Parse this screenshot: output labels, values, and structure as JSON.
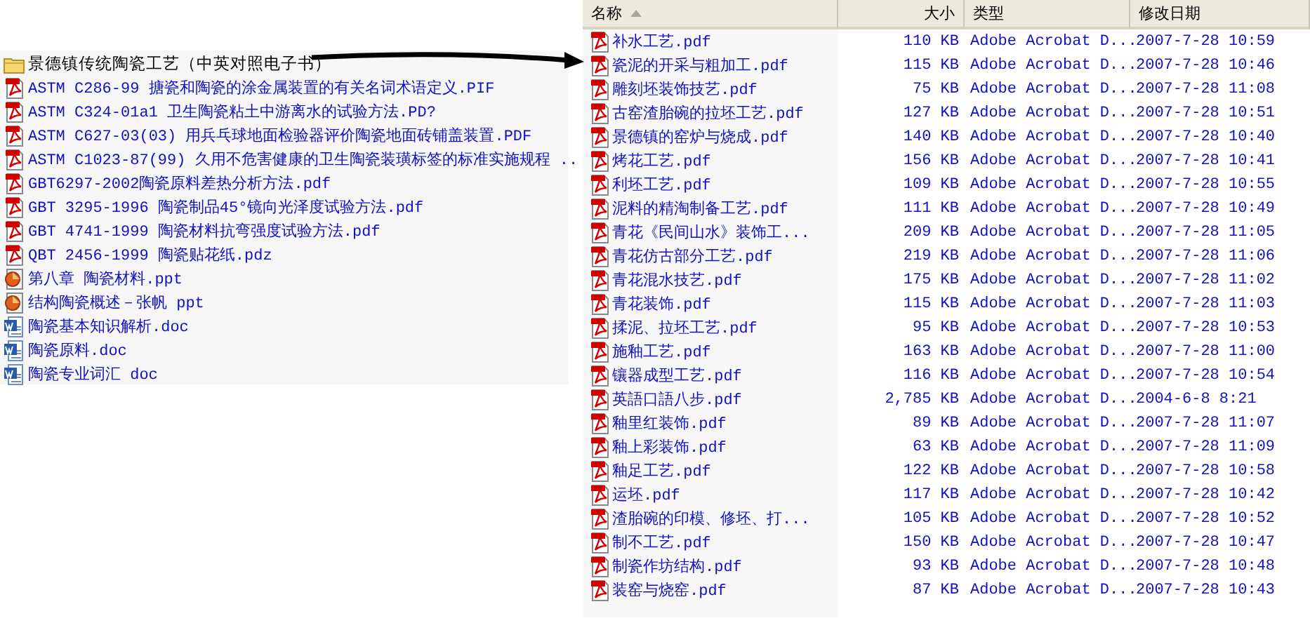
{
  "left_panel": {
    "folder": {
      "kind": "folder",
      "name": "景德镇传统陶瓷工艺（中英对照电子书）"
    },
    "files": [
      {
        "kind": "pdf",
        "name": "ASTM C286-99 搪瓷和陶瓷的涂金属装置的有关名词术语定义.PIF"
      },
      {
        "kind": "pdf",
        "name": "ASTM C324-01a1 卫生陶瓷粘土中游离水的试验方法.PD?"
      },
      {
        "kind": "pdf",
        "name": "ASTM C627-03(03)  用兵乓球地面检验器评价陶瓷地面砖铺盖装置.PDF"
      },
      {
        "kind": "pdf",
        "name": "ASTM C1023-87(99)  久用不危害健康的卫生陶瓷装璜标签的标准实施规程 .."
      },
      {
        "kind": "pdf",
        "name": "GBT6297-2002陶瓷原料差热分析方法.pdf"
      },
      {
        "kind": "pdf",
        "name": "GBT 3295-1996 陶瓷制品45°镜向光泽度试验方法.pdf"
      },
      {
        "kind": "pdf",
        "name": "GBT 4741-1999 陶瓷材料抗弯强度试验方法.pdf"
      },
      {
        "kind": "pdf",
        "name": "QBT 2456-1999 陶瓷贴花纸.pdz"
      },
      {
        "kind": "ppt",
        "name": "第八章 陶瓷材料.ppt"
      },
      {
        "kind": "ppt",
        "name": "结构陶瓷概述－张帆 ppt"
      },
      {
        "kind": "doc",
        "name": "陶瓷基本知识解析.doc"
      },
      {
        "kind": "doc",
        "name": "陶瓷原料.doc"
      },
      {
        "kind": "doc",
        "name": "陶瓷专业词汇 doc"
      }
    ]
  },
  "file_table": {
    "columns": [
      "名称",
      "大小",
      "类型",
      "修改日期"
    ],
    "rows": [
      {
        "kind": "pdf",
        "name": "补水工艺.pdf",
        "size": "110 KB",
        "type": "Adobe Acrobat D...",
        "modified": "2007-7-28 10:59"
      },
      {
        "kind": "pdf",
        "name": "瓷泥的开采与粗加工.pdf",
        "size": "115 KB",
        "type": "Adobe Acrobat D...",
        "modified": "2007-7-28 10:46"
      },
      {
        "kind": "pdf",
        "name": "雕刻坯装饰技艺.pdf",
        "size": "75 KB",
        "type": "Adobe Acrobat D...",
        "modified": "2007-7-28 11:08"
      },
      {
        "kind": "pdf",
        "name": "古窑渣胎碗的拉坯工艺.pdf",
        "size": "127 KB",
        "type": "Adobe Acrobat D...",
        "modified": "2007-7-28 10:51"
      },
      {
        "kind": "pdf",
        "name": "景德镇的窑炉与烧成.pdf",
        "size": "140 KB",
        "type": "Adobe Acrobat D...",
        "modified": "2007-7-28 10:40"
      },
      {
        "kind": "pdf",
        "name": "烤花工艺.pdf",
        "size": "156 KB",
        "type": "Adobe Acrobat D...",
        "modified": "2007-7-28 10:41"
      },
      {
        "kind": "pdf",
        "name": "利坯工艺.pdf",
        "size": "109 KB",
        "type": "Adobe Acrobat D...",
        "modified": "2007-7-28 10:55"
      },
      {
        "kind": "pdf",
        "name": "泥料的精淘制备工艺.pdf",
        "size": "111 KB",
        "type": "Adobe Acrobat D...",
        "modified": "2007-7-28 10:49"
      },
      {
        "kind": "pdf",
        "name": "青花《民间山水》装饰工...",
        "size": "209 KB",
        "type": "Adobe Acrobat D...",
        "modified": "2007-7-28 11:05"
      },
      {
        "kind": "pdf",
        "name": "青花仿古部分工艺.pdf",
        "size": "219 KB",
        "type": "Adobe Acrobat D...",
        "modified": "2007-7-28 11:06"
      },
      {
        "kind": "pdf",
        "name": "青花混水技艺.pdf",
        "size": "175 KB",
        "type": "Adobe Acrobat D...",
        "modified": "2007-7-28 11:02"
      },
      {
        "kind": "pdf",
        "name": "青花装饰.pdf",
        "size": "115 KB",
        "type": "Adobe Acrobat D...",
        "modified": "2007-7-28 11:03"
      },
      {
        "kind": "pdf",
        "name": "揉泥、拉坯工艺.pdf",
        "size": "95 KB",
        "type": "Adobe Acrobat D...",
        "modified": "2007-7-28 10:53"
      },
      {
        "kind": "pdf",
        "name": "施釉工艺.pdf",
        "size": "163 KB",
        "type": "Adobe Acrobat D...",
        "modified": "2007-7-28 11:00"
      },
      {
        "kind": "pdf",
        "name": "镶器成型工艺.pdf",
        "size": "116 KB",
        "type": "Adobe Acrobat D...",
        "modified": "2007-7-28 10:54"
      },
      {
        "kind": "pdf",
        "name": "英語口語八步.pdf",
        "size": "2,785 KB",
        "type": "Adobe Acrobat D...",
        "modified": "2004-6-8 8:21"
      },
      {
        "kind": "pdf",
        "name": "釉里红装饰.pdf",
        "size": "89 KB",
        "type": "Adobe Acrobat D...",
        "modified": "2007-7-28 11:07"
      },
      {
        "kind": "pdf",
        "name": "釉上彩装饰.pdf",
        "size": "63 KB",
        "type": "Adobe Acrobat D...",
        "modified": "2007-7-28 11:09"
      },
      {
        "kind": "pdf",
        "name": "釉足工艺.pdf",
        "size": "122 KB",
        "type": "Adobe Acrobat D...",
        "modified": "2007-7-28 10:58"
      },
      {
        "kind": "pdf",
        "name": "运坯.pdf",
        "size": "117 KB",
        "type": "Adobe Acrobat D...",
        "modified": "2007-7-28 10:42"
      },
      {
        "kind": "pdf",
        "name": "渣胎碗的印模、修坯、打...",
        "size": "105 KB",
        "type": "Adobe Acrobat D...",
        "modified": "2007-7-28 10:52"
      },
      {
        "kind": "pdf",
        "name": "制不工艺.pdf",
        "size": "150 KB",
        "type": "Adobe Acrobat D...",
        "modified": "2007-7-28 10:47"
      },
      {
        "kind": "pdf",
        "name": "制瓷作坊结构.pdf",
        "size": "93 KB",
        "type": "Adobe Acrobat D...",
        "modified": "2007-7-28 10:48"
      },
      {
        "kind": "pdf",
        "name": "装窑与烧窑.pdf",
        "size": "87 KB",
        "type": "Adobe Acrobat D...",
        "modified": "2007-7-28 10:43"
      }
    ]
  }
}
